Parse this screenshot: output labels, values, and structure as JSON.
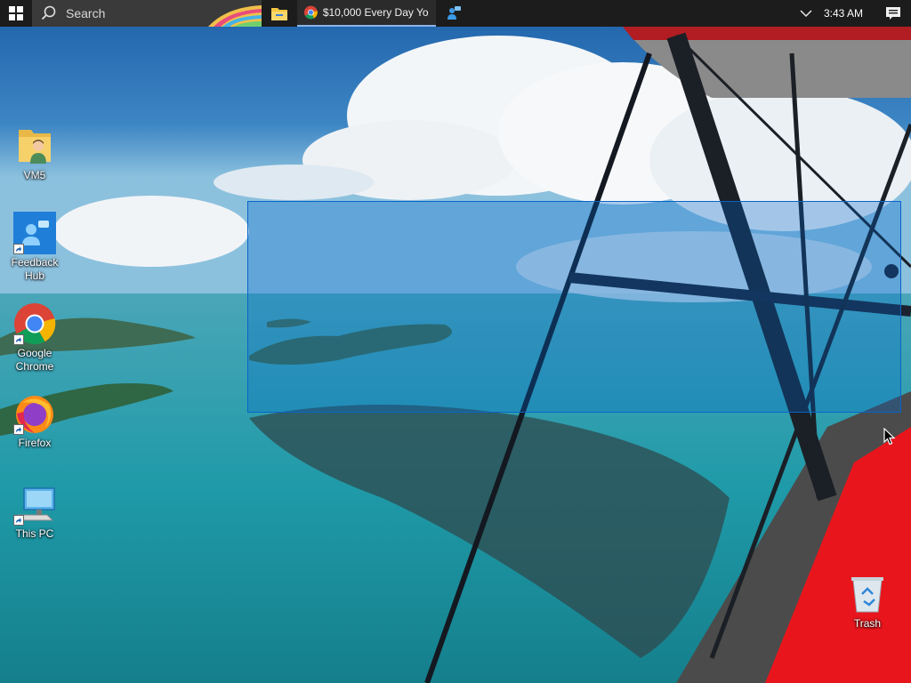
{
  "taskbar": {
    "search_placeholder": "Search",
    "app_title": "$10,000 Every Day Yo...",
    "clock": "3:43 AM"
  },
  "desktop": {
    "icons": [
      {
        "label": "VM5"
      },
      {
        "label": "Feedback Hub"
      },
      {
        "label": "Google Chrome"
      },
      {
        "label": "Firefox"
      },
      {
        "label": "This PC"
      },
      {
        "label": "Trash"
      }
    ]
  },
  "colors": {
    "taskbar_bg": "#1c1c1c",
    "selection_fill": "rgba(0,102,204,0.3)",
    "selection_border": "#0a64c8",
    "plane_wing_red": "#e8161c"
  }
}
